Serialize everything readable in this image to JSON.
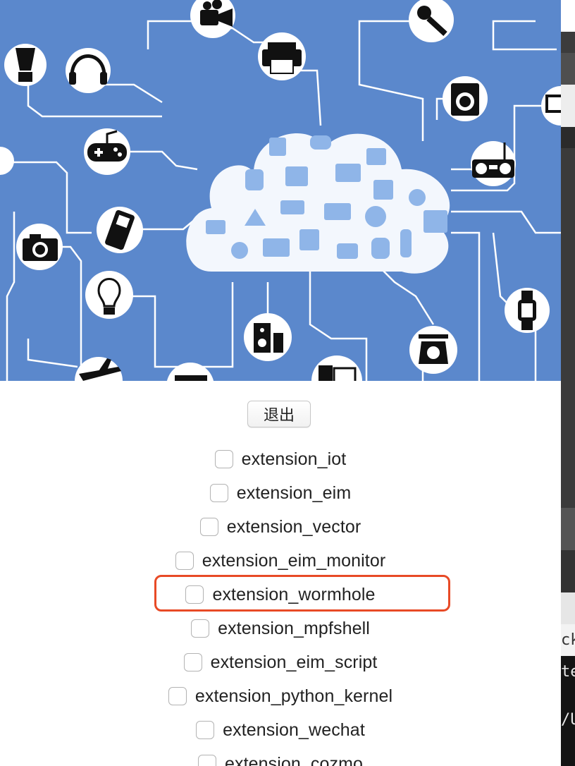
{
  "hero": {
    "illustration": "iot-cloud-network",
    "background_color": "#5b88cc",
    "node_icons": [
      "blender-icon",
      "headphones-icon",
      "video-camera-icon",
      "printer-icon",
      "microphone-icon",
      "washing-machine-icon",
      "monitor-icon",
      "gamepad-icon",
      "boombox-icon",
      "mobile-phone-icon",
      "camera-icon",
      "lightbulb-icon",
      "speaker-icon",
      "kitchen-scale-icon",
      "smartwatch-icon",
      "airplane-icon",
      "projector-icon",
      "computer-tower-icon"
    ]
  },
  "exit_button": {
    "label": "退出"
  },
  "extensions": [
    {
      "label": "extension_iot",
      "checked": false
    },
    {
      "label": "extension_eim",
      "checked": false
    },
    {
      "label": "extension_vector",
      "checked": false
    },
    {
      "label": "extension_eim_monitor",
      "checked": false
    },
    {
      "label": "extension_wormhole",
      "checked": false,
      "highlighted": true
    },
    {
      "label": "extension_mpfshell",
      "checked": false
    },
    {
      "label": "extension_eim_script",
      "checked": false
    },
    {
      "label": "extension_python_kernel",
      "checked": false
    },
    {
      "label": "extension_wechat",
      "checked": false
    },
    {
      "label": "extension_cozmo",
      "checked": false
    }
  ],
  "highlight_color": "#e84a26",
  "background_window": {
    "fragments": [
      "ck",
      "te",
      "/U"
    ]
  }
}
